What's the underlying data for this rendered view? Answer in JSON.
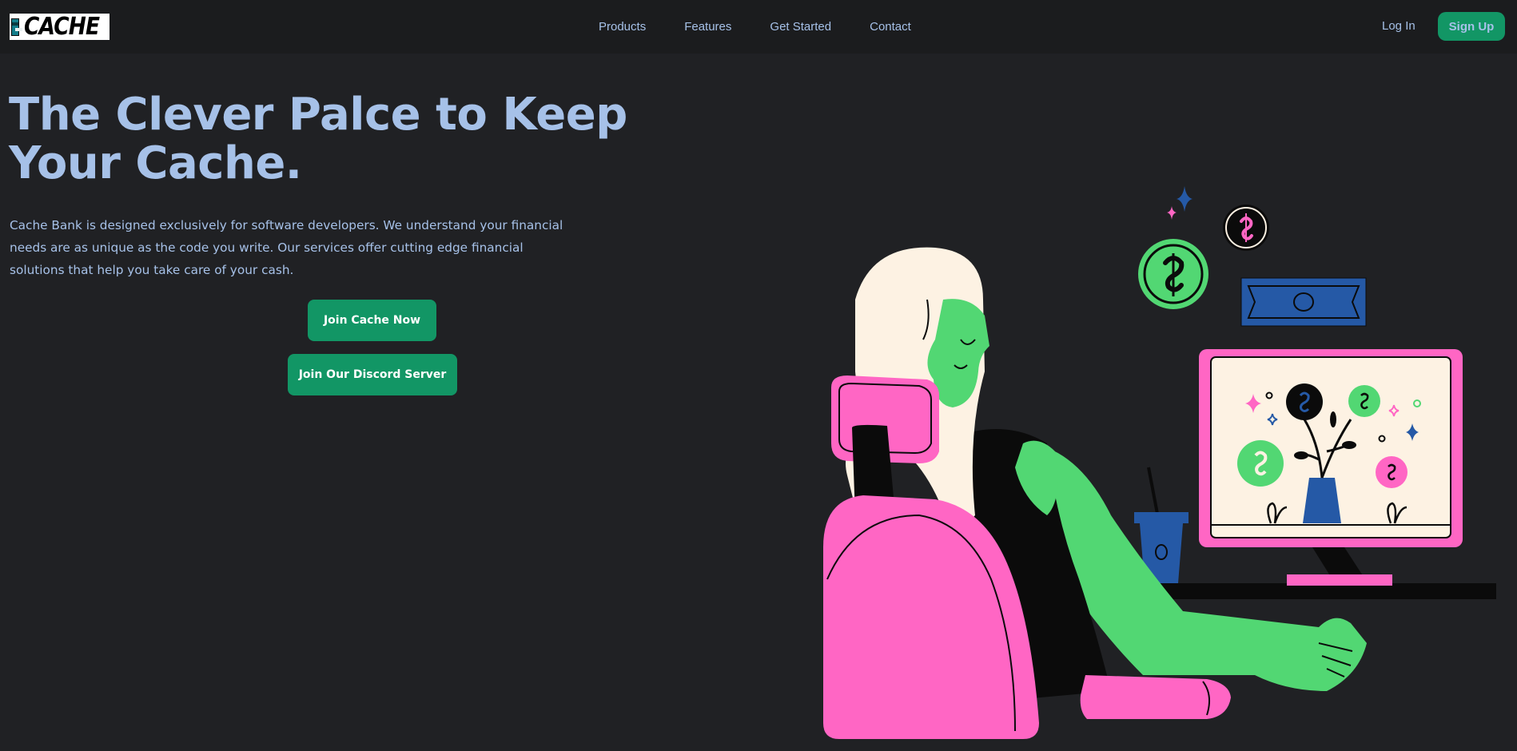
{
  "brand": {
    "logo_text": "CACHE"
  },
  "nav": {
    "links": [
      "Products",
      "Features",
      "Get Started",
      "Contact"
    ],
    "login_label": "Log In",
    "signup_label": "Sign Up"
  },
  "hero": {
    "title": "The Clever Palce to Keep Your Cache.",
    "description": "Cache Bank is designed exclusively for software developers. We understand your financial needs are as unique as the code you write. Our services offer cutting edge financial solutions that help you take care of your cash.",
    "cta_primary": "Join Cache Now",
    "cta_secondary": "Join Our Discord Server"
  },
  "colors": {
    "background": "#202124",
    "navbar": "#1b1c1e",
    "text": "#a6c1e8",
    "accent": "#129665",
    "illustration_pink": "#ff66c4",
    "illustration_green": "#52d773",
    "illustration_blue": "#2559a6",
    "illustration_cream": "#fdf2e3"
  },
  "illustration": {
    "icons": [
      "dollar-coin-icon",
      "banknote-icon",
      "sparkle-icon",
      "monitor-icon",
      "cup-icon"
    ]
  }
}
